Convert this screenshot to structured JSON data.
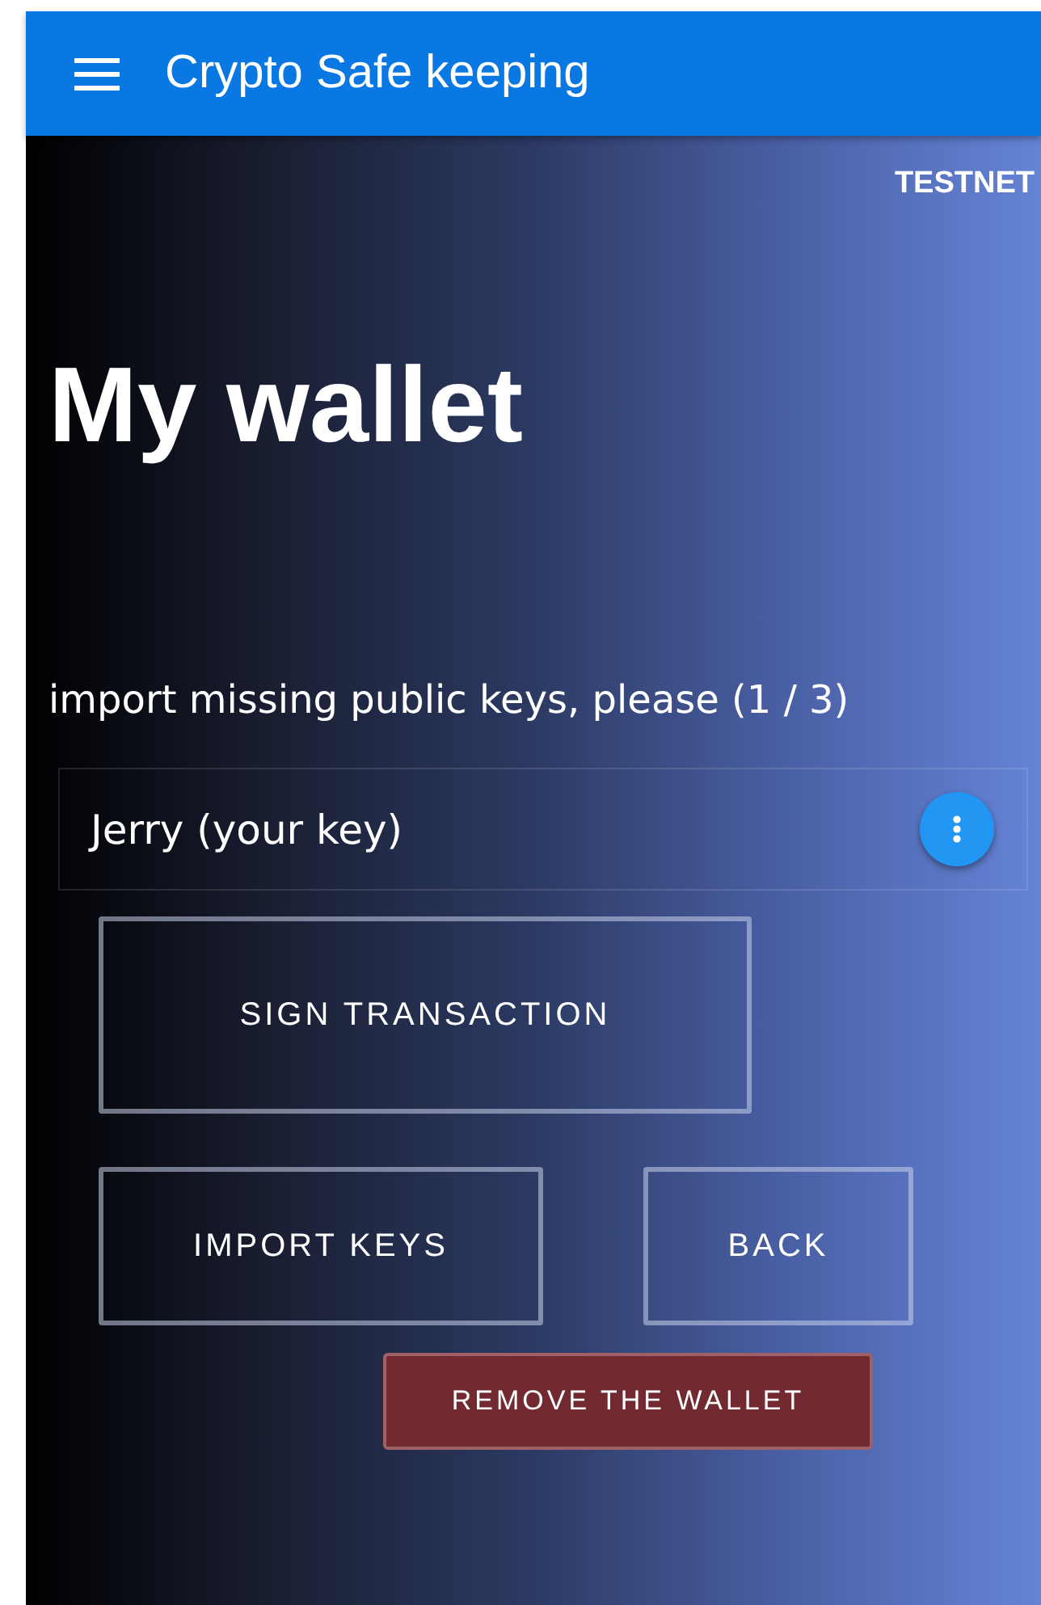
{
  "app_bar": {
    "title": "Crypto Safe keeping"
  },
  "network": "TESTNET",
  "heading": "My wallet",
  "prompt": "import missing public keys, please (1 / 3)",
  "keys": [
    {
      "name": "Jerry (your key)"
    }
  ],
  "buttons": [
    {
      "label": "SIGN TRANSACTION",
      "kind": "outlined"
    },
    {
      "label": "IMPORT KEYS",
      "kind": "outlined"
    },
    {
      "label": "BACK",
      "kind": "outlined"
    },
    {
      "label": "REMOVE THE WALLET",
      "kind": "danger"
    }
  ]
}
